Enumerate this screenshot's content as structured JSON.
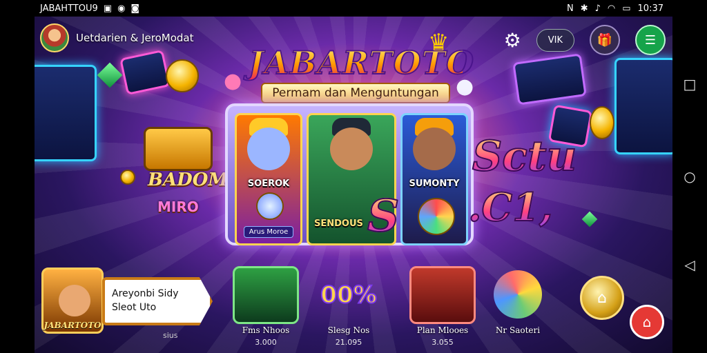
{
  "status_bar": {
    "left_text": "JABAHTTOU9",
    "time": "10:37"
  },
  "profile": {
    "name": "Uetdarien & JeroModat"
  },
  "top_bar": {
    "vip_label": "VIK"
  },
  "logo": {
    "title": "JABARTOTO",
    "subtitle": "Permam dan Menguntungan"
  },
  "left_art": {
    "chest_label": "BADOM",
    "small_label": "MIRO"
  },
  "featured_cards": [
    {
      "label": "SOEROK",
      "sub": "Arus Moroe"
    },
    {
      "label": "SENDOUS",
      "sub": ""
    },
    {
      "label": "SUMONTY",
      "sub": ""
    }
  ],
  "side_promo": {
    "line1": "Sctu",
    "line2": ".C1,"
  },
  "player_card": {
    "tag": "JABARTOTO",
    "line1": "Areyonbi Sidy",
    "line2": "Sleot Uto"
  },
  "tiles": [
    {
      "label": "Fms Nhoos",
      "value": "3.000"
    },
    {
      "label": "Slesg Nos",
      "value": "21.095",
      "badge": "00%"
    },
    {
      "label": "Plan Mlooes",
      "value": "3.055"
    },
    {
      "label": "Nr Saoteri",
      "value": ""
    }
  ],
  "bottom_small_label": "sius",
  "colors": {
    "accent_green": "#16a34a",
    "accent_gold": "#f5b400",
    "accent_purple": "#6b4fc6",
    "fab_red": "#e53935"
  }
}
